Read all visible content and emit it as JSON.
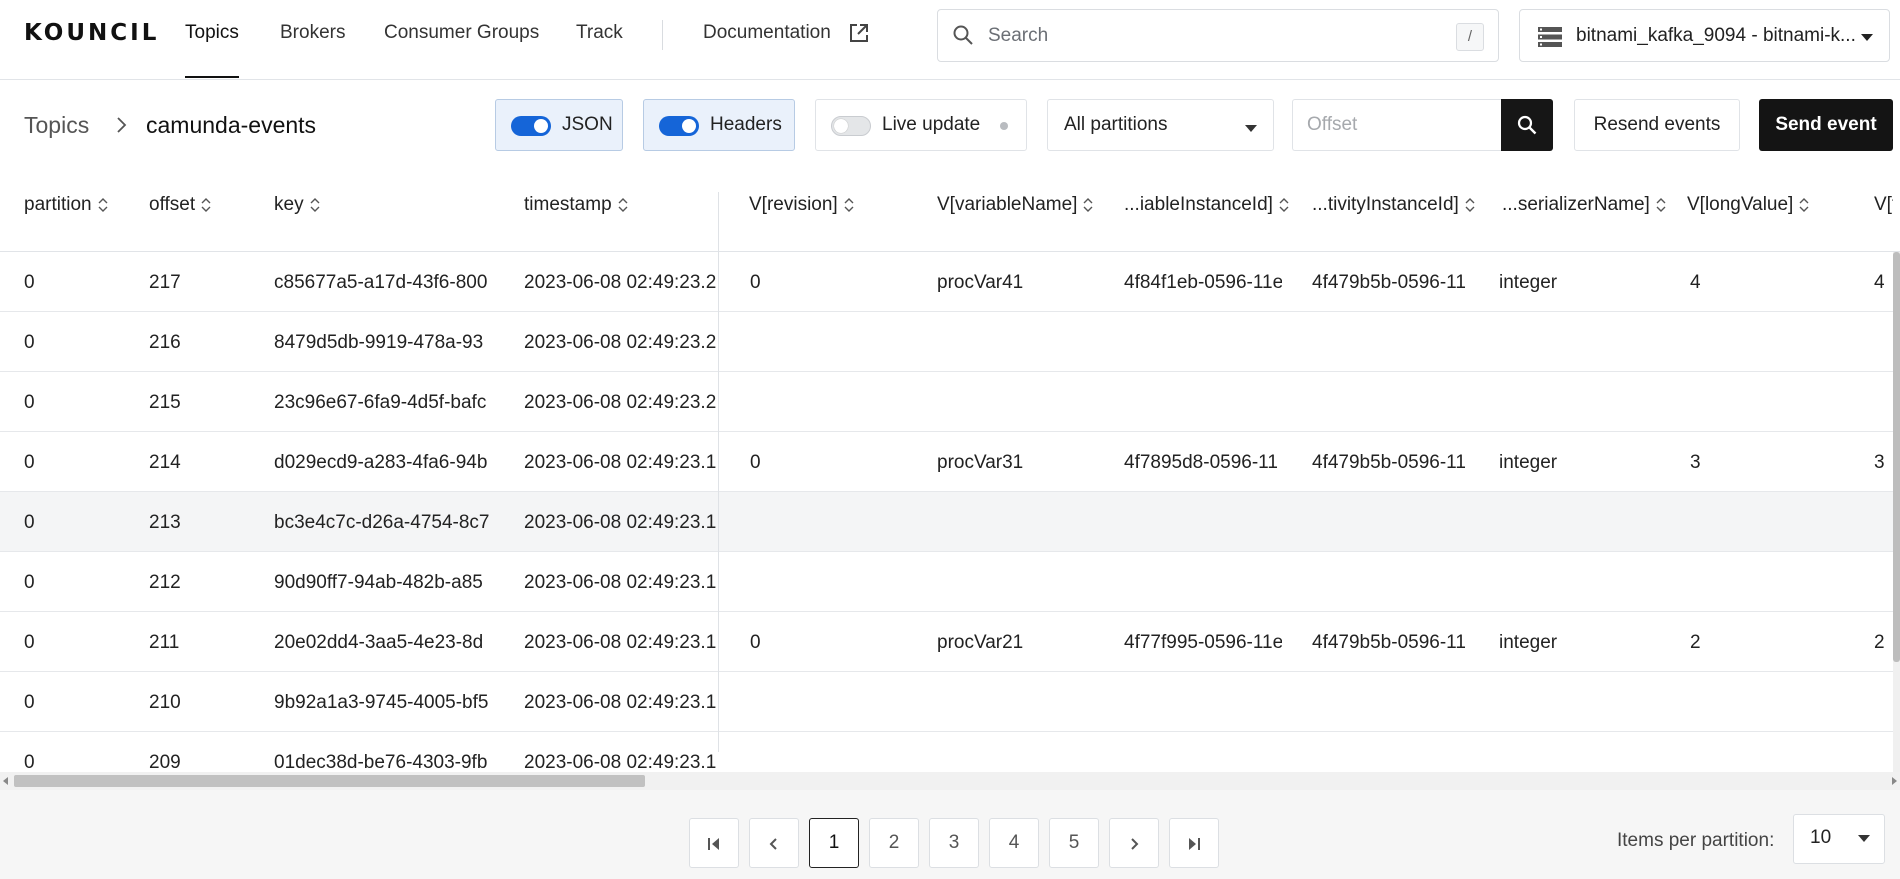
{
  "nav": {
    "logo": "KOUNCIL",
    "items": [
      {
        "label": "Topics",
        "active": true
      },
      {
        "label": "Brokers",
        "active": false
      },
      {
        "label": "Consumer Groups",
        "active": false
      },
      {
        "label": "Track",
        "active": false
      }
    ],
    "documentation": "Documentation",
    "search_placeholder": "Search",
    "search_shortcut": "/",
    "cluster": "bitnami_kafka_9094 - bitnami-k..."
  },
  "toolbar": {
    "breadcrumb_root": "Topics",
    "breadcrumb_current": "camunda-events",
    "json_toggle": {
      "label": "JSON",
      "on": true
    },
    "headers_toggle": {
      "label": "Headers",
      "on": true
    },
    "live_update": {
      "label": "Live update",
      "on": false
    },
    "partition_select": "All partitions",
    "offset_placeholder": "Offset",
    "resend_label": "Resend events",
    "send_label": "Send event"
  },
  "table": {
    "columns": [
      "partition",
      "offset",
      "key",
      "timestamp",
      "V[revision]",
      "V[variableName]",
      "...iableInstanceId]",
      "...tivityInstanceId]",
      "...serializerName]",
      "V[longValue]",
      "V[t"
    ],
    "rows": [
      {
        "partition": "0",
        "offset": "217",
        "key": "c85677a5-a17d-43f6-800",
        "timestamp": "2023-06-08 02:49:23.2",
        "revision": "0",
        "variableName": "procVar41",
        "instanceId": "4f84f1eb-0596-11e",
        "activityInstanceId": "4f479b5b-0596-11",
        "serializerName": "integer",
        "longValue": "4",
        "last": "4"
      },
      {
        "partition": "0",
        "offset": "216",
        "key": "8479d5db-9919-478a-93",
        "timestamp": "2023-06-08 02:49:23.2",
        "revision": "",
        "variableName": "",
        "instanceId": "",
        "activityInstanceId": "",
        "serializerName": "",
        "longValue": "",
        "last": ""
      },
      {
        "partition": "0",
        "offset": "215",
        "key": "23c96e67-6fa9-4d5f-bafc",
        "timestamp": "2023-06-08 02:49:23.2",
        "revision": "",
        "variableName": "",
        "instanceId": "",
        "activityInstanceId": "",
        "serializerName": "",
        "longValue": "",
        "last": ""
      },
      {
        "partition": "0",
        "offset": "214",
        "key": "d029ecd9-a283-4fa6-94b",
        "timestamp": "2023-06-08 02:49:23.1",
        "revision": "0",
        "variableName": "procVar31",
        "instanceId": "4f7895d8-0596-11",
        "activityInstanceId": "4f479b5b-0596-11",
        "serializerName": "integer",
        "longValue": "3",
        "last": "3"
      },
      {
        "partition": "0",
        "offset": "213",
        "key": "bc3e4c7c-d26a-4754-8c7",
        "timestamp": "2023-06-08 02:49:23.1",
        "revision": "",
        "variableName": "",
        "instanceId": "",
        "activityInstanceId": "",
        "serializerName": "",
        "longValue": "",
        "last": ""
      },
      {
        "partition": "0",
        "offset": "212",
        "key": "90d90ff7-94ab-482b-a85",
        "timestamp": "2023-06-08 02:49:23.1",
        "revision": "",
        "variableName": "",
        "instanceId": "",
        "activityInstanceId": "",
        "serializerName": "",
        "longValue": "",
        "last": ""
      },
      {
        "partition": "0",
        "offset": "211",
        "key": "20e02dd4-3aa5-4e23-8d",
        "timestamp": "2023-06-08 02:49:23.1",
        "revision": "0",
        "variableName": "procVar21",
        "instanceId": "4f77f995-0596-11e",
        "activityInstanceId": "4f479b5b-0596-11",
        "serializerName": "integer",
        "longValue": "2",
        "last": "2"
      },
      {
        "partition": "0",
        "offset": "210",
        "key": "9b92a1a3-9745-4005-bf5",
        "timestamp": "2023-06-08 02:49:23.1",
        "revision": "",
        "variableName": "",
        "instanceId": "",
        "activityInstanceId": "",
        "serializerName": "",
        "longValue": "",
        "last": ""
      },
      {
        "partition": "0",
        "offset": "209",
        "key": "01dec38d-be76-4303-9fb",
        "timestamp": "2023-06-08 02:49:23.1",
        "revision": "",
        "variableName": "",
        "instanceId": "",
        "activityInstanceId": "",
        "serializerName": "",
        "longValue": "",
        "last": ""
      }
    ]
  },
  "pagination": {
    "pages": [
      "1",
      "2",
      "3",
      "4",
      "5"
    ],
    "current_page": "1",
    "items_per_partition_label": "Items per partition:",
    "items_per_partition": "10"
  },
  "colors": {
    "accent": "#1565d8",
    "dark_button": "#141414"
  }
}
